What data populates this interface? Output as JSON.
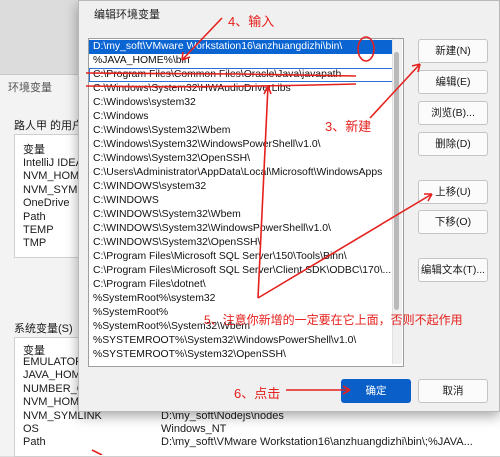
{
  "background_window": {
    "title": "环境变量",
    "user_vars_label": "路人甲 的用户",
    "user_vars_header": "变量",
    "user_vars": [
      "IntelliJ IDEA",
      "NVM_HOME",
      "NVM_SYML",
      "OneDrive",
      "Path",
      "TEMP",
      "TMP"
    ],
    "system_vars_label": "系统变量(S)",
    "system_vars_header": "变量",
    "system_vars": [
      {
        "name": "EMULATOR",
        "value": ""
      },
      {
        "name": "JAVA_HOM",
        "value": ""
      },
      {
        "name": "NUMBER_C",
        "value": ""
      },
      {
        "name": "NVM_HOM",
        "value": ""
      },
      {
        "name": "NVM_SYMLINK",
        "value": "D:\\my_soft\\Nodejs\\nodes"
      },
      {
        "name": "OS",
        "value": "Windows_NT"
      },
      {
        "name": "Path",
        "value": "D:\\my_soft\\VMware Workstation16\\anzhuangdizhi\\bin\\;%JAVA..."
      }
    ]
  },
  "dialog": {
    "title": "编辑环境变量",
    "paths": [
      "D:\\my_soft\\VMware Workstation16\\anzhuangdizhi\\bin\\",
      "%JAVA_HOME%\\bin",
      "C:\\Program Files\\Common Files\\Oracle\\Java\\javapath",
      "C:\\Windows\\System32\\HWAudioDriverLibs",
      "C:\\Windows\\system32",
      "C:\\Windows",
      "C:\\Windows\\System32\\Wbem",
      "C:\\Windows\\System32\\WindowsPowerShell\\v1.0\\",
      "C:\\Windows\\System32\\OpenSSH\\",
      "C:\\Users\\Administrator\\AppData\\Local\\Microsoft\\WindowsApps",
      "C:\\WINDOWS\\system32",
      "C:\\WINDOWS",
      "C:\\WINDOWS\\System32\\Wbem",
      "C:\\WINDOWS\\System32\\WindowsPowerShell\\v1.0\\",
      "C:\\WINDOWS\\System32\\OpenSSH\\",
      "C:\\Program Files\\Microsoft SQL Server\\150\\Tools\\Binn\\",
      "C:\\Program Files\\Microsoft SQL Server\\Client SDK\\ODBC\\170\\...",
      "C:\\Program Files\\dotnet\\",
      "%SystemRoot%\\system32",
      "%SystemRoot%",
      "%SystemRoot%\\System32\\Wbem",
      "%SYSTEMROOT%\\System32\\WindowsPowerShell\\v1.0\\",
      "%SYSTEMROOT%\\System32\\OpenSSH\\"
    ],
    "buttons": {
      "new": "新建(N)",
      "edit": "编辑(E)",
      "browse": "浏览(B)...",
      "delete": "删除(D)",
      "move_up": "上移(U)",
      "move_down": "下移(O)",
      "edit_text": "编辑文本(T)...",
      "ok": "确定",
      "cancel": "取消"
    }
  },
  "annotations": {
    "step3": "3、新建",
    "step4": "4、输入",
    "step5": "5、注意你新增的一定要在它上面，否则不起作用",
    "step6": "6、点击"
  },
  "colors": {
    "annotation": "#e5201d",
    "selection": "#0a64d2",
    "primary_button": "#0a5fc8"
  }
}
